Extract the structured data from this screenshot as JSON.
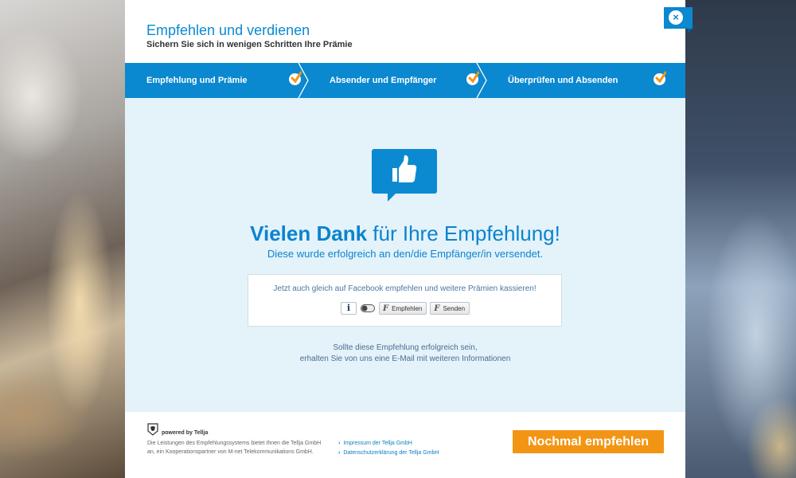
{
  "header": {
    "title": "Empfehlen und verdienen",
    "subtitle": "Sichern Sie sich in wenigen Schritten Ihre Prämie"
  },
  "steps": [
    {
      "label": "Empfehlung und Prämie",
      "completed": true
    },
    {
      "label": "Absender und Empfänger",
      "completed": true
    },
    {
      "label": "Überprüfen und Absenden",
      "completed": true
    }
  ],
  "confirmation": {
    "headline_bold": "Vielen Dank",
    "headline_rest": " für Ihre Empfehlung!",
    "sent_message": "Diese wurde erfolgreich an den/die Empfänger/in versendet.",
    "icon": "thumbs-up-icon"
  },
  "facebook": {
    "prompt": "Jetzt auch gleich auf Facebook empfehlen und weitere Prämien kassieren!",
    "info_label": "i",
    "like_label": "Empfehlen",
    "send_label": "Senden"
  },
  "notice": {
    "line1": "Sollte diese Empfehlung erfolgreich sein,",
    "line2": "erhalten Sie von uns eine E-Mail mit weiteren Informationen"
  },
  "footer": {
    "powered_by": "powered by Tellja",
    "legal_line1": "Die Leistungen des Empfehlungssystems bietet Ihnen die Tellja GmbH",
    "legal_line2": "an, ein Kooperationspartner von M-net Telekommunikations GmbH.",
    "link_impressum": "Impressum der Tellja GmbH",
    "link_privacy": "Datenschutzerklärung der Tellja GmbH",
    "cta_label": "Nochmal empfehlen"
  },
  "close": {
    "label": "×"
  },
  "colors": {
    "brand_blue": "#0a88d0",
    "cta_orange": "#f39514",
    "content_bg": "#e4f2fa"
  }
}
